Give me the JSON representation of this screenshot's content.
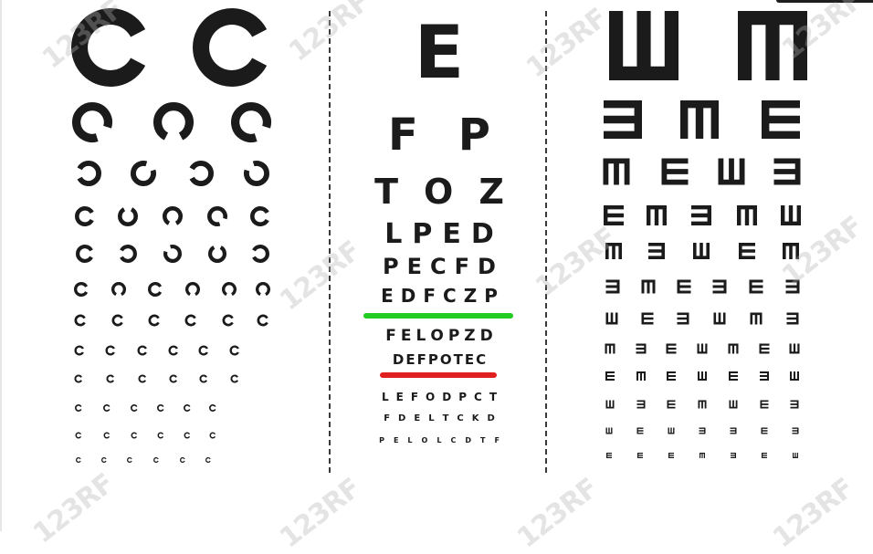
{
  "colors": {
    "optotype": "#1b1b1b",
    "green_line": "#22cc22",
    "red_line": "#e02020",
    "divider": "#3a3a3a",
    "watermark": "#b4b4b4"
  },
  "landolt_chart": {
    "icon": "landolt-c-icon",
    "rows": [
      [
        "right",
        "right"
      ],
      [
        "down-right",
        "down",
        "down-right"
      ],
      [
        "left",
        "up-right",
        "left",
        "up-left"
      ],
      [
        "right",
        "up",
        "down",
        "down-right",
        "right"
      ],
      [
        "right",
        "left",
        "up-left",
        "up",
        "left"
      ],
      [
        "right",
        "down",
        "right",
        "down",
        "down",
        "down"
      ],
      [
        "right",
        "right",
        "right",
        "right",
        "right",
        "right"
      ],
      [
        "right",
        "right",
        "right",
        "right",
        "right",
        "right"
      ],
      [
        "right",
        "right",
        "right",
        "right",
        "right",
        "right"
      ],
      [
        "right",
        "right",
        "right",
        "right",
        "right",
        "right"
      ],
      [
        "right",
        "right",
        "right",
        "right",
        "right",
        "right"
      ],
      [
        "right",
        "right",
        "right",
        "right",
        "right",
        "right"
      ]
    ]
  },
  "snellen_chart": {
    "rows": [
      "E",
      "FP",
      "TOZ",
      "LPED",
      "PECFD",
      "EDFCZP",
      "FELOPZD",
      "DEFPOTEC",
      "LEFODPCT",
      "FDELTCKD",
      "PELOLCDTF"
    ]
  },
  "tumbling_e_chart": {
    "icon": "tumbling-e-icon",
    "rows": [
      [
        "up",
        "down"
      ],
      [
        "left",
        "down",
        "right"
      ],
      [
        "down",
        "right",
        "up",
        "left"
      ],
      [
        "right",
        "down",
        "left",
        "down",
        "up"
      ],
      [
        "down",
        "left",
        "up",
        "right",
        "down"
      ],
      [
        "left",
        "down",
        "right",
        "left",
        "right",
        "left"
      ],
      [
        "up",
        "right",
        "left",
        "up",
        "down",
        "left"
      ],
      [
        "down",
        "left",
        "right",
        "up",
        "down",
        "right",
        "up"
      ],
      [
        "right",
        "down",
        "right",
        "up",
        "right",
        "left",
        "up"
      ],
      [
        "up",
        "left",
        "right",
        "down",
        "up",
        "right",
        "left"
      ],
      [
        "up",
        "right",
        "up",
        "left",
        "left",
        "right",
        "left"
      ],
      [
        "right",
        "right",
        "right",
        "down",
        "left",
        "right",
        "up"
      ]
    ]
  },
  "watermark": {
    "text": "123RF",
    "icon": "camera-aperture-icon"
  }
}
